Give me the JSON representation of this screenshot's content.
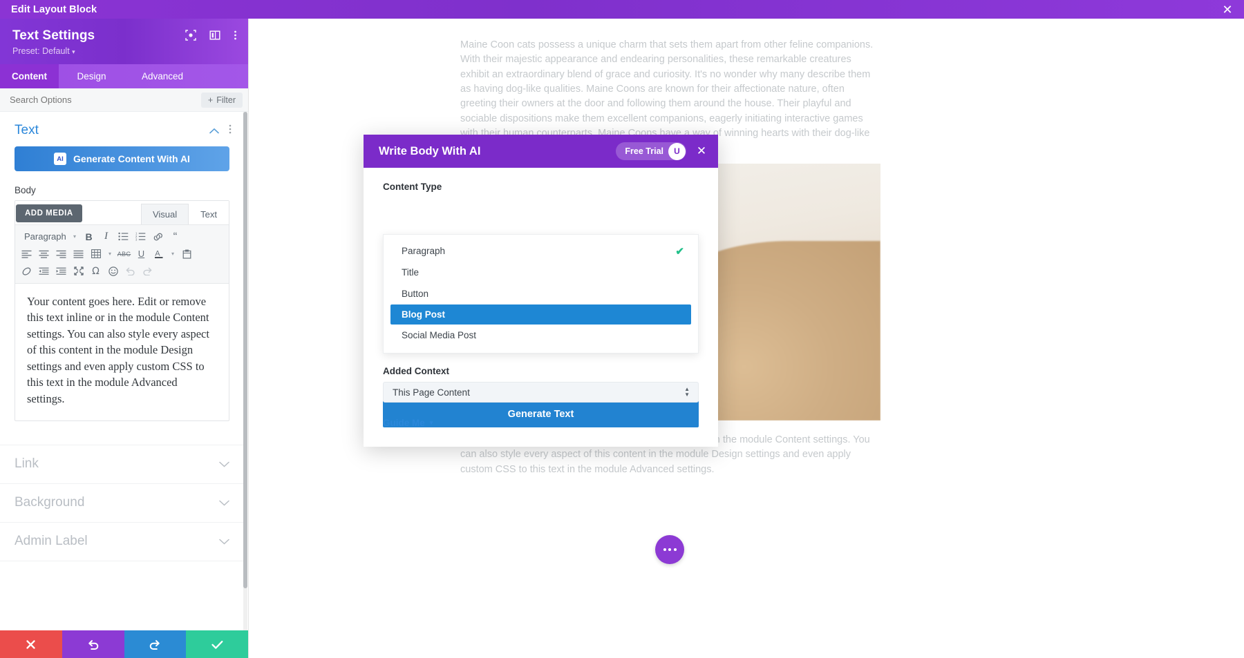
{
  "topbar": {
    "title": "Edit Layout Block",
    "close_icon": "close-icon"
  },
  "panel": {
    "title": "Text Settings",
    "preset": "Preset: Default",
    "preset_caret": "▾",
    "header_icons": [
      "target-icon",
      "layout-columns-icon",
      "vertical-dots-icon"
    ],
    "tabs": [
      {
        "label": "Content",
        "active": true
      },
      {
        "label": "Design",
        "active": false
      },
      {
        "label": "Advanced",
        "active": false
      }
    ],
    "search": {
      "placeholder": "Search Options",
      "value": ""
    },
    "filter_button": {
      "label": "Filter",
      "plus": "+"
    },
    "section": {
      "title": "Text",
      "collapse_icon": "chevron-up-icon",
      "menu_icon": "vertical-dots-icon"
    },
    "ai_button": {
      "badge": "AI",
      "label": "Generate Content With AI"
    },
    "body_label": "Body",
    "add_media": "ADD MEDIA",
    "editor_tabs": [
      {
        "label": "Visual",
        "active": true
      },
      {
        "label": "Text",
        "active": false
      }
    ],
    "toolbar": {
      "format_select": "Paragraph",
      "caret": "▾",
      "row1": [
        "bold-icon",
        "italic-icon",
        "bulleted-list-icon",
        "numbered-list-icon",
        "link-icon",
        "blockquote-icon"
      ],
      "row2": [
        "align-left-icon",
        "align-center-icon",
        "align-right-icon",
        "align-justify-icon",
        "table-icon",
        "table-caret-icon",
        "strikethrough-icon",
        "underline-icon",
        "text-color-icon",
        "text-color-caret-icon",
        "paste-icon"
      ],
      "row3": [
        "clear-formatting-icon",
        "outdent-icon",
        "indent-icon",
        "fullscreen-icon",
        "special-character-icon",
        "emoji-icon",
        "undo-icon",
        "redo-icon"
      ]
    },
    "editor_content": "Your content goes here. Edit or remove this text inline or in the module Content settings. You can also style every aspect of this content in the module Design settings and even apply custom CSS to this text in the module Advanced settings.",
    "accordions": [
      {
        "label": "Link",
        "chevron": "chevron-down-icon"
      },
      {
        "label": "Background",
        "chevron": "chevron-down-icon"
      },
      {
        "label": "Admin Label",
        "chevron": "chevron-down-icon"
      }
    ],
    "footer_buttons": [
      {
        "name": "discard-button",
        "icon": "x-icon",
        "color": "#eb4d4b"
      },
      {
        "name": "undo-button",
        "icon": "undo-icon",
        "color": "#8c3ad4"
      },
      {
        "name": "redo-button",
        "icon": "redo-icon",
        "color": "#2b8bd4"
      },
      {
        "name": "save-button",
        "icon": "check-icon",
        "color": "#2ecc9b"
      }
    ]
  },
  "canvas": {
    "paragraph_top": "Maine Coon cats possess a unique charm that sets them apart from other feline companions. With their majestic appearance and endearing personalities, these remarkable creatures exhibit an extraordinary blend of grace and curiosity. It's no wonder why many describe them as having dog-like qualities. Maine Coons are known for their affectionate nature, often greeting their owners at the door and following them around the house. Their playful and sociable dispositions make them excellent companions, eagerly initiating interactive games with their human counterparts. Maine Coons have a way of winning hearts with their dog-like charm and",
    "paragraph_bottom": "Your content goes here. Edit or remove this text inline or in the module Content settings. You can also style every aspect of this content in the module Design settings and even apply custom CSS to this text in the module Advanced settings.",
    "fab": "more-options-button"
  },
  "dialog": {
    "title": "Write Body With AI",
    "trial_label": "Free Trial",
    "avatar_initial": "U",
    "close_icon": "close-icon",
    "content_type_label": "Content Type",
    "content_type_options": [
      {
        "label": "Paragraph",
        "checked": true,
        "highlighted": false
      },
      {
        "label": "Title",
        "checked": false,
        "highlighted": false
      },
      {
        "label": "Button",
        "checked": false,
        "highlighted": false
      },
      {
        "label": "Blog Post",
        "checked": false,
        "highlighted": true
      },
      {
        "label": "Social Media Post",
        "checked": false,
        "highlighted": false
      }
    ],
    "check_glyph": "✔",
    "added_context_label": "Added Context",
    "added_context_value": "This Page Content",
    "guide_me_label": "Guide Me",
    "guide_me_caret": "▾",
    "generate_button": "Generate Text"
  },
  "colors": {
    "brand_purple": "#7b2bc9",
    "topbar_purple": "#8b34d4",
    "accent_blue": "#2283d1",
    "highlight_red": "#f63a46",
    "check_green": "#22c08a",
    "selected_blue": "#1e87d4"
  }
}
